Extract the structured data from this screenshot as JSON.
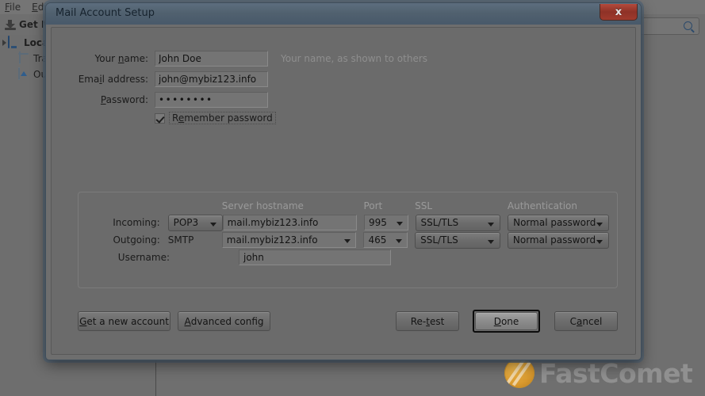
{
  "background": {
    "menu_items": [
      {
        "pre": "",
        "acc": "F",
        "post": "ile"
      },
      {
        "pre": "",
        "acc": "E",
        "post": "dit"
      }
    ],
    "toolbar_button": "Get M",
    "toolbar_icon": "download-icon",
    "search_placeholder": "",
    "search_icon": "search-icon",
    "folders": [
      {
        "label": "Local",
        "icon": "monitor-icon"
      },
      {
        "label": "Tras",
        "icon": "trash-icon"
      },
      {
        "label": "Out",
        "icon": "outbox-icon"
      }
    ]
  },
  "watermark": {
    "text": "FastComet",
    "logo": "comet-coin-logo"
  },
  "dialog": {
    "title": "Mail Account Setup",
    "close_glyph": "x",
    "close_icon": "close-icon",
    "account": {
      "name": {
        "label_pre": "Your ",
        "label_acc": "n",
        "label_post": "ame:",
        "value": "John Doe",
        "hint": "Your name, as shown to others"
      },
      "email": {
        "label_pre": "Ema",
        "label_acc": "i",
        "label_post": "l address:",
        "value": "john@mybiz123.info"
      },
      "password": {
        "label_pre": "",
        "label_acc": "P",
        "label_post": "assword:",
        "value": "••••••••"
      },
      "remember": {
        "label_pre": "R",
        "label_acc": "e",
        "label_post": "member password",
        "checked": true
      }
    },
    "server": {
      "headers": {
        "hostname": "Server hostname",
        "port": "Port",
        "ssl": "SSL",
        "auth": "Authentication"
      },
      "rows": [
        {
          "label": "Incoming:",
          "protocol": "POP3",
          "protocol_type": "dropdown",
          "hostname": "mail.mybiz123.info",
          "hostname_has_caret": false,
          "port": "995",
          "ssl": "SSL/TLS",
          "auth": "Normal password"
        },
        {
          "label": "Outgoing:",
          "protocol": "SMTP",
          "protocol_type": "text",
          "hostname": "mail.mybiz123.info",
          "hostname_has_caret": true,
          "port": "465",
          "ssl": "SSL/TLS",
          "auth": "Normal password"
        }
      ],
      "username": {
        "label": "Username:",
        "value": "john"
      }
    },
    "buttons": {
      "new_account": {
        "pre": "",
        "acc": "G",
        "post": "et a new account"
      },
      "advanced": {
        "pre": "",
        "acc": "A",
        "post": "dvanced config"
      },
      "retest": {
        "pre": "Re-",
        "acc": "t",
        "post": "est"
      },
      "done": {
        "pre": "",
        "acc": "D",
        "post": "one",
        "focused": true
      },
      "cancel": {
        "pre": "C",
        "acc": "a",
        "post": "ncel"
      }
    }
  }
}
